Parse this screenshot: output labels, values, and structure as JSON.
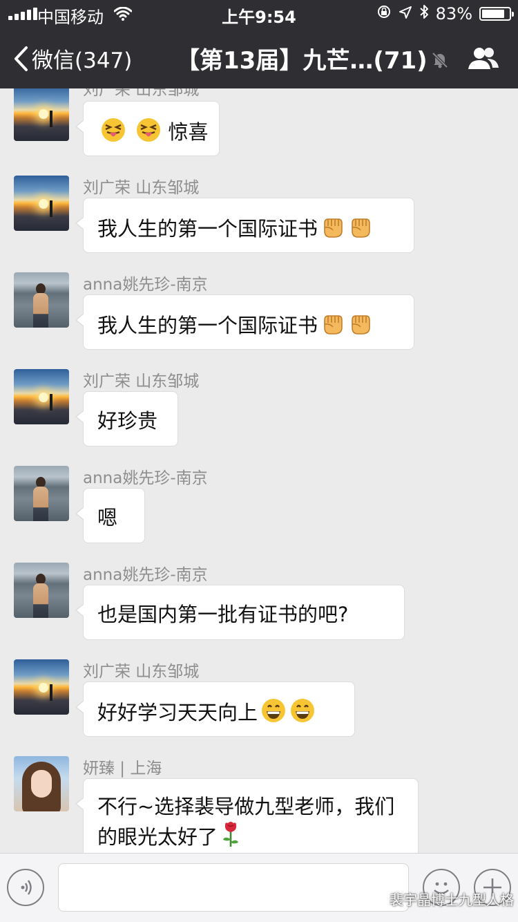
{
  "status_bar": {
    "carrier": "中国移动",
    "time": "上午9:54",
    "battery_percent": "83%",
    "battery_level": 0.83
  },
  "nav": {
    "back_label": "微信(347)",
    "title": "【第13届】九芒…(71)"
  },
  "messages": [
    {
      "sender": "刘广荣 山东邹城",
      "text": "惊喜",
      "avatar": "sunset-avatar",
      "emoji": "squinting-tongue-emoji"
    },
    {
      "sender": "刘广荣 山东邹城",
      "text": "我人生的第一个国际证书",
      "avatar": "sunset-avatar",
      "emoji": "raised-fist-emoji"
    },
    {
      "sender": "anna姚先珍-南京",
      "text": "我人生的第一个国际证书",
      "avatar": "anna-avatar",
      "emoji": "raised-fist-emoji"
    },
    {
      "sender": "刘广荣 山东邹城",
      "text": "好珍贵",
      "avatar": "sunset-avatar"
    },
    {
      "sender": "anna姚先珍-南京",
      "text": "嗯",
      "avatar": "anna-avatar"
    },
    {
      "sender": "anna姚先珍-南京",
      "text": "也是国内第一批有证书的吧?",
      "avatar": "anna-avatar"
    },
    {
      "sender": "刘广荣 山东邹城",
      "text": "好好学习天天向上",
      "avatar": "sunset-avatar",
      "emoji": "grinning-emoji"
    },
    {
      "sender": "妍臻 | 上海",
      "text": "不行~选择裴导做九型老师，我们的眼光太好了",
      "avatar": "yan-avatar",
      "emoji": "rose-emoji"
    }
  ],
  "first_message_partial_sender": "刘广荣 山东邹城",
  "input": {
    "placeholder": ""
  },
  "watermark": "裴宇晶博士九型人格",
  "colors": {
    "nav_background": "#2e2e33",
    "chat_background": "#ebebeb",
    "bubble": "#ffffff",
    "sender_name": "#8e8e8e"
  }
}
